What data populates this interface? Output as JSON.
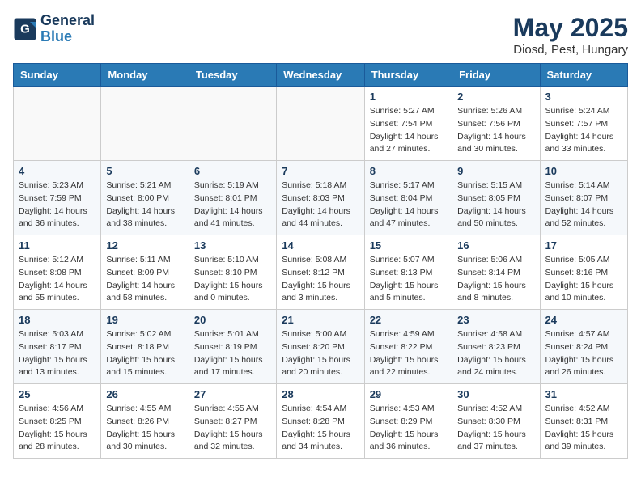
{
  "header": {
    "logo_line1": "General",
    "logo_line2": "Blue",
    "month": "May 2025",
    "location": "Diosd, Pest, Hungary"
  },
  "weekdays": [
    "Sunday",
    "Monday",
    "Tuesday",
    "Wednesday",
    "Thursday",
    "Friday",
    "Saturday"
  ],
  "weeks": [
    [
      {
        "day": "",
        "info": ""
      },
      {
        "day": "",
        "info": ""
      },
      {
        "day": "",
        "info": ""
      },
      {
        "day": "",
        "info": ""
      },
      {
        "day": "1",
        "info": "Sunrise: 5:27 AM\nSunset: 7:54 PM\nDaylight: 14 hours\nand 27 minutes."
      },
      {
        "day": "2",
        "info": "Sunrise: 5:26 AM\nSunset: 7:56 PM\nDaylight: 14 hours\nand 30 minutes."
      },
      {
        "day": "3",
        "info": "Sunrise: 5:24 AM\nSunset: 7:57 PM\nDaylight: 14 hours\nand 33 minutes."
      }
    ],
    [
      {
        "day": "4",
        "info": "Sunrise: 5:23 AM\nSunset: 7:59 PM\nDaylight: 14 hours\nand 36 minutes."
      },
      {
        "day": "5",
        "info": "Sunrise: 5:21 AM\nSunset: 8:00 PM\nDaylight: 14 hours\nand 38 minutes."
      },
      {
        "day": "6",
        "info": "Sunrise: 5:19 AM\nSunset: 8:01 PM\nDaylight: 14 hours\nand 41 minutes."
      },
      {
        "day": "7",
        "info": "Sunrise: 5:18 AM\nSunset: 8:03 PM\nDaylight: 14 hours\nand 44 minutes."
      },
      {
        "day": "8",
        "info": "Sunrise: 5:17 AM\nSunset: 8:04 PM\nDaylight: 14 hours\nand 47 minutes."
      },
      {
        "day": "9",
        "info": "Sunrise: 5:15 AM\nSunset: 8:05 PM\nDaylight: 14 hours\nand 50 minutes."
      },
      {
        "day": "10",
        "info": "Sunrise: 5:14 AM\nSunset: 8:07 PM\nDaylight: 14 hours\nand 52 minutes."
      }
    ],
    [
      {
        "day": "11",
        "info": "Sunrise: 5:12 AM\nSunset: 8:08 PM\nDaylight: 14 hours\nand 55 minutes."
      },
      {
        "day": "12",
        "info": "Sunrise: 5:11 AM\nSunset: 8:09 PM\nDaylight: 14 hours\nand 58 minutes."
      },
      {
        "day": "13",
        "info": "Sunrise: 5:10 AM\nSunset: 8:10 PM\nDaylight: 15 hours\nand 0 minutes."
      },
      {
        "day": "14",
        "info": "Sunrise: 5:08 AM\nSunset: 8:12 PM\nDaylight: 15 hours\nand 3 minutes."
      },
      {
        "day": "15",
        "info": "Sunrise: 5:07 AM\nSunset: 8:13 PM\nDaylight: 15 hours\nand 5 minutes."
      },
      {
        "day": "16",
        "info": "Sunrise: 5:06 AM\nSunset: 8:14 PM\nDaylight: 15 hours\nand 8 minutes."
      },
      {
        "day": "17",
        "info": "Sunrise: 5:05 AM\nSunset: 8:16 PM\nDaylight: 15 hours\nand 10 minutes."
      }
    ],
    [
      {
        "day": "18",
        "info": "Sunrise: 5:03 AM\nSunset: 8:17 PM\nDaylight: 15 hours\nand 13 minutes."
      },
      {
        "day": "19",
        "info": "Sunrise: 5:02 AM\nSunset: 8:18 PM\nDaylight: 15 hours\nand 15 minutes."
      },
      {
        "day": "20",
        "info": "Sunrise: 5:01 AM\nSunset: 8:19 PM\nDaylight: 15 hours\nand 17 minutes."
      },
      {
        "day": "21",
        "info": "Sunrise: 5:00 AM\nSunset: 8:20 PM\nDaylight: 15 hours\nand 20 minutes."
      },
      {
        "day": "22",
        "info": "Sunrise: 4:59 AM\nSunset: 8:22 PM\nDaylight: 15 hours\nand 22 minutes."
      },
      {
        "day": "23",
        "info": "Sunrise: 4:58 AM\nSunset: 8:23 PM\nDaylight: 15 hours\nand 24 minutes."
      },
      {
        "day": "24",
        "info": "Sunrise: 4:57 AM\nSunset: 8:24 PM\nDaylight: 15 hours\nand 26 minutes."
      }
    ],
    [
      {
        "day": "25",
        "info": "Sunrise: 4:56 AM\nSunset: 8:25 PM\nDaylight: 15 hours\nand 28 minutes."
      },
      {
        "day": "26",
        "info": "Sunrise: 4:55 AM\nSunset: 8:26 PM\nDaylight: 15 hours\nand 30 minutes."
      },
      {
        "day": "27",
        "info": "Sunrise: 4:55 AM\nSunset: 8:27 PM\nDaylight: 15 hours\nand 32 minutes."
      },
      {
        "day": "28",
        "info": "Sunrise: 4:54 AM\nSunset: 8:28 PM\nDaylight: 15 hours\nand 34 minutes."
      },
      {
        "day": "29",
        "info": "Sunrise: 4:53 AM\nSunset: 8:29 PM\nDaylight: 15 hours\nand 36 minutes."
      },
      {
        "day": "30",
        "info": "Sunrise: 4:52 AM\nSunset: 8:30 PM\nDaylight: 15 hours\nand 37 minutes."
      },
      {
        "day": "31",
        "info": "Sunrise: 4:52 AM\nSunset: 8:31 PM\nDaylight: 15 hours\nand 39 minutes."
      }
    ]
  ]
}
